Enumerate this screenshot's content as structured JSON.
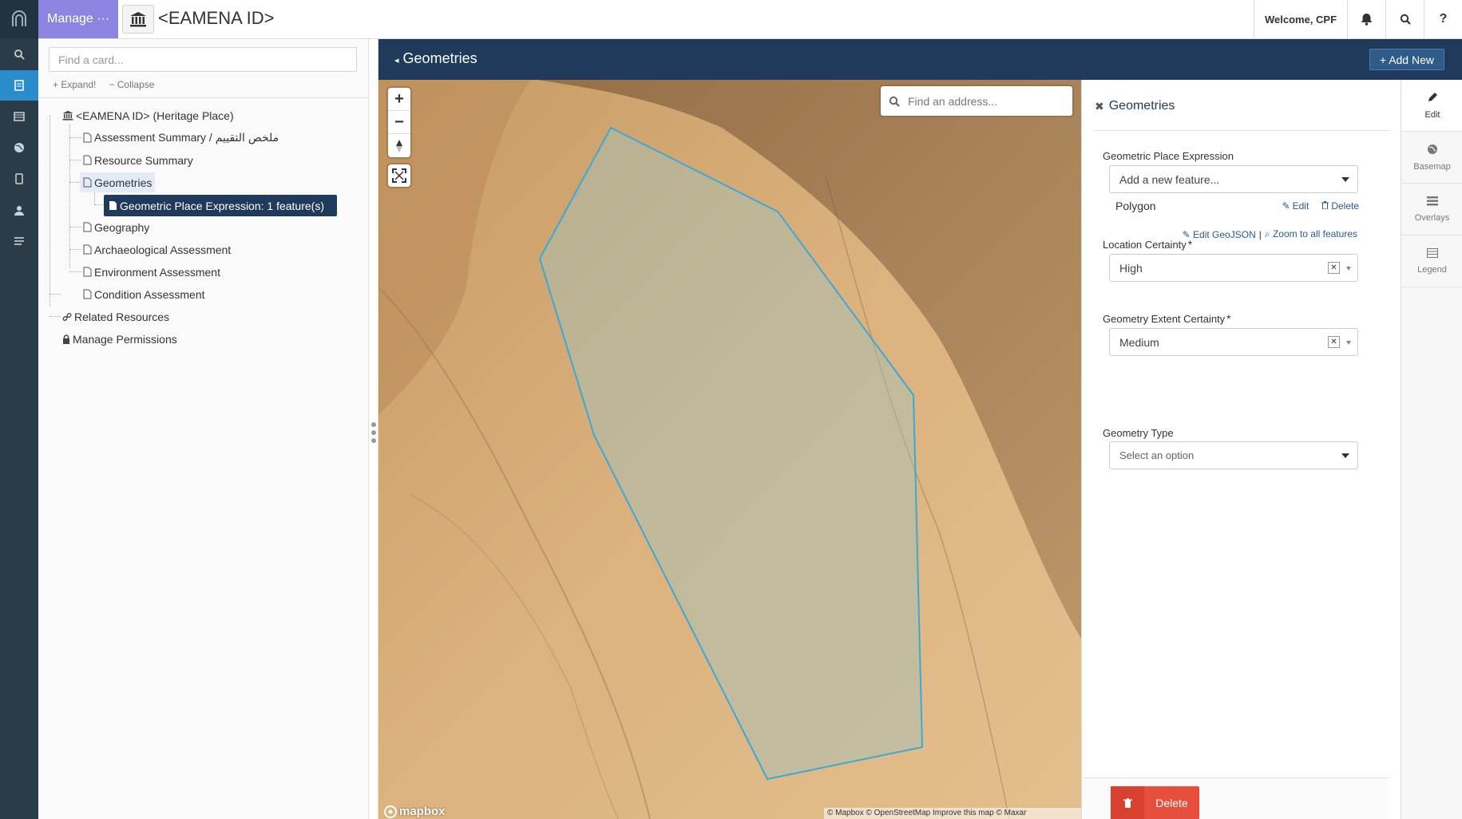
{
  "topbar": {
    "manage_label": "Manage ···",
    "resource_title": "<EAMENA ID>",
    "welcome": "Welcome, CPF"
  },
  "icons": {
    "bell": "bell-icon",
    "search": "search-icon",
    "help": "help-icon",
    "resource": "museum-icon"
  },
  "card_panel": {
    "search_placeholder": "Find a card...",
    "expand_label": "Expand!",
    "collapse_label": "Collapse",
    "tree": {
      "root": "<EAMENA ID> (Heritage Place)",
      "items": [
        "Assessment Summary / ملخص التقييم",
        "Resource Summary",
        "Geometries",
        "Geometric Place Expression: 1 feature(s)",
        "Geography",
        "Archaeological Assessment",
        "Environment Assessment",
        "Condition Assessment"
      ],
      "related": "Related Resources",
      "permissions": "Manage Permissions"
    }
  },
  "main": {
    "header_title": "Geometries",
    "add_new_label": "Add New"
  },
  "map": {
    "geocoder_placeholder": "Find an address...",
    "logo_text": "mapbox",
    "attribution": "© Mapbox © OpenStreetMap Improve this map © Maxar",
    "polygon_color": "#3aa9d8"
  },
  "form": {
    "title": "Geometries",
    "geometric_place_expression_label": "Geometric Place Expression",
    "add_feature_placeholder": "Add a new feature...",
    "feature_type": "Polygon",
    "edit_label": "Edit",
    "delete_label": "Delete",
    "edit_geojson_label": "Edit GeoJSON",
    "link_sep": "|",
    "zoom_all_label": "Zoom to all features",
    "location_certainty_label": "Location Certainty",
    "location_certainty_value": "High",
    "geometry_extent_label": "Geometry Extent Certainty",
    "geometry_extent_value": "Medium",
    "geometry_type_label": "Geometry Type",
    "geometry_type_placeholder": "Select an option",
    "required_mark": "*",
    "footer_delete": "Delete"
  },
  "toolrail": {
    "edit": "Edit",
    "basemap": "Basemap",
    "overlays": "Overlays",
    "legend": "Legend"
  },
  "colors": {
    "rail": "#2b3b47",
    "manage": "#8d83e0",
    "header": "#1f3a5a",
    "delete": "#e84e3c",
    "active_nav": "#2a8ccb"
  }
}
